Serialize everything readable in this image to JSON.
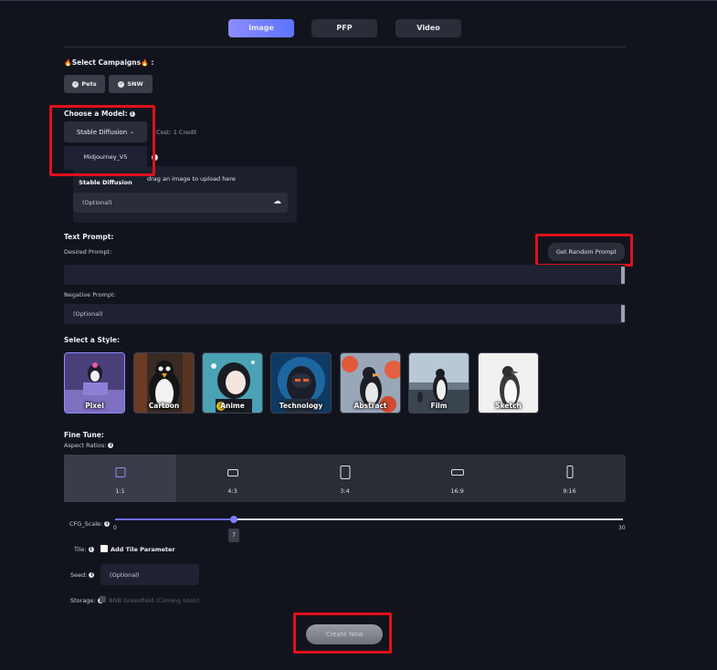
{
  "tabs": [
    {
      "label": "Image",
      "active": true
    },
    {
      "label": "PFP",
      "active": false
    },
    {
      "label": "Video",
      "active": false
    }
  ],
  "campaigns": {
    "label": "Select Campaigns",
    "fire_icon": "🔥",
    "colon": ":",
    "chips": [
      "Pets",
      "SNW"
    ]
  },
  "model": {
    "label": "Choose a Model:",
    "selected": "Stable Diffusion",
    "cost": "Cost: 1 Credit",
    "options": [
      "Midjourney_V5",
      "Stable Diffusion"
    ]
  },
  "upload": {
    "hint": "drag an image to upload here",
    "placeholder": "(Optional)"
  },
  "text_prompt": {
    "label": "Text Prompt:",
    "desired_label": "Desired Prompt:",
    "random_button": "Get Random Prompt",
    "desired_value": "",
    "negative_label": "Negative Prompt:",
    "negative_placeholder": "(Optional)"
  },
  "styles": {
    "label": "Select a Style:",
    "items": [
      "Pixel",
      "Cartoon",
      "Anime",
      "Technology",
      "Abstract",
      "Film",
      "Sketch"
    ]
  },
  "fine_tune": {
    "label": "Fine Tune:",
    "aspect_label": "Aspect Ratios:",
    "aspect_ratios": [
      "1:1",
      "4:3",
      "3:4",
      "16:9",
      "9:16"
    ],
    "selected_ratio": "1:1",
    "cfg_label": "CFG_Scale:",
    "cfg_min": "0",
    "cfg_max": "30",
    "cfg_value": "7",
    "tile_label": "Tile:",
    "tile_option": "Add Tile Parameter",
    "seed_label": "Seed:",
    "seed_placeholder": "(Optional)",
    "storage_label": "Storage:",
    "storage_option": "BNB Greenfield (Coming soon)"
  },
  "create_button": "Create Now",
  "colors": {
    "accent": "#8d8cff",
    "highlight": "#e0101a",
    "bg": "#12141d"
  }
}
